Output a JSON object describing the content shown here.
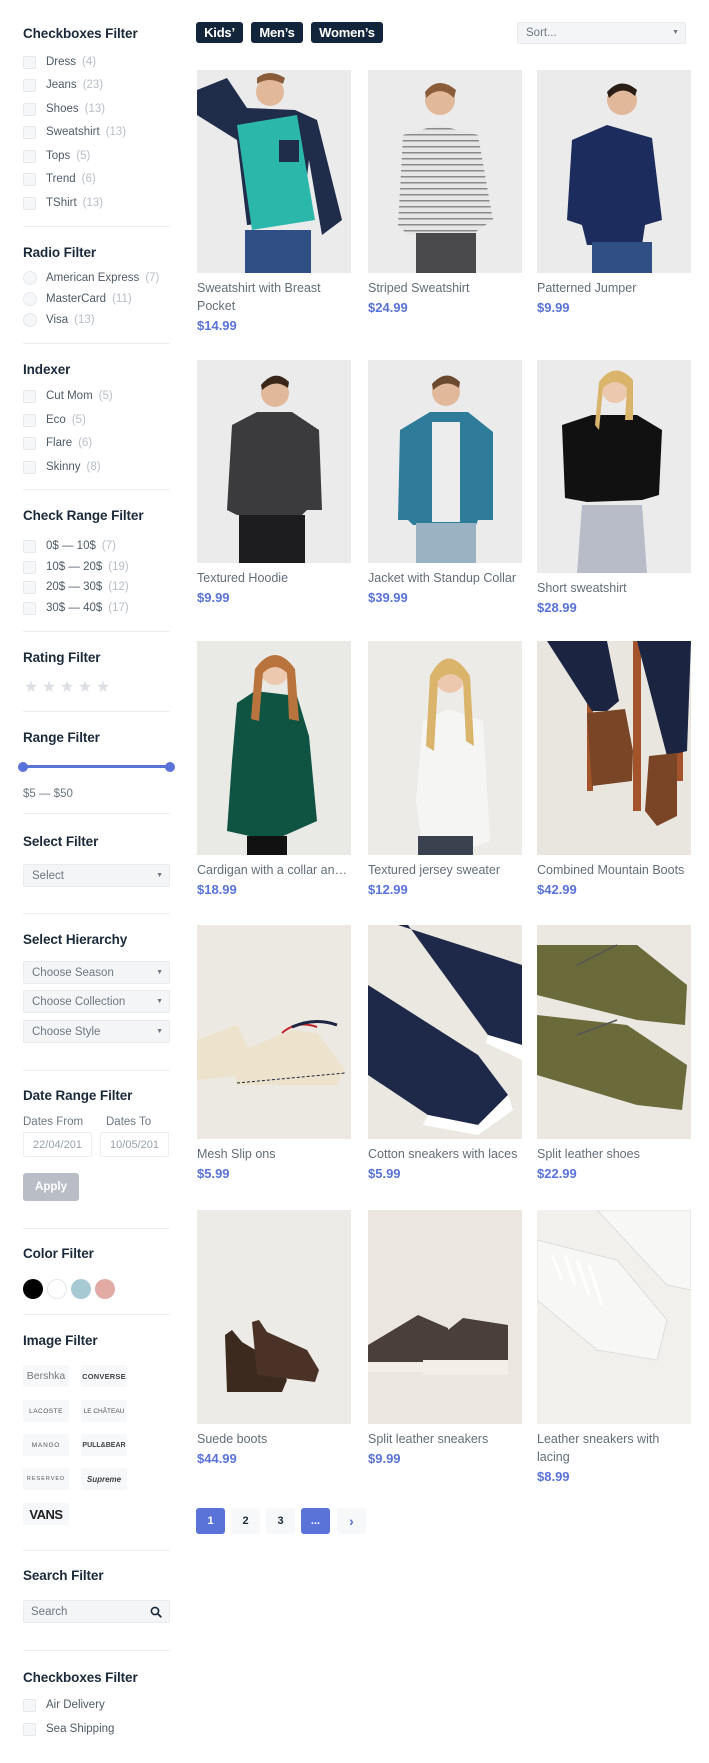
{
  "categories": [
    "Kids’",
    "Men’s",
    "Women’s"
  ],
  "sort": {
    "placeholder": "Sort..."
  },
  "sidebar": {
    "checkboxes_filter": {
      "title": "Checkboxes Filter",
      "items": [
        {
          "label": "Dress",
          "count": "(4)"
        },
        {
          "label": "Jeans",
          "count": "(23)"
        },
        {
          "label": "Shoes",
          "count": "(13)"
        },
        {
          "label": "Sweatshirt",
          "count": "(13)"
        },
        {
          "label": "Tops",
          "count": "(5)"
        },
        {
          "label": "Trend",
          "count": "(6)"
        },
        {
          "label": "TShirt",
          "count": "(13)"
        }
      ]
    },
    "radio_filter": {
      "title": "Radio Filter",
      "items": [
        {
          "label": "American Express",
          "count": "(7)"
        },
        {
          "label": "MasterCard",
          "count": "(11)"
        },
        {
          "label": "Visa",
          "count": "(13)"
        }
      ]
    },
    "indexer": {
      "title": "Indexer",
      "items": [
        {
          "label": "Cut Mom",
          "count": "(5)"
        },
        {
          "label": "Eco",
          "count": "(5)"
        },
        {
          "label": "Flare",
          "count": "(6)"
        },
        {
          "label": "Skinny",
          "count": "(8)"
        }
      ]
    },
    "check_range_filter": {
      "title": "Check Range Filter",
      "items": [
        {
          "label": "0$ — 10$",
          "count": "(7)"
        },
        {
          "label": "10$ — 20$",
          "count": "(19)"
        },
        {
          "label": "20$ — 30$",
          "count": "(12)"
        },
        {
          "label": "30$ — 40$",
          "count": "(17)"
        }
      ]
    },
    "rating_filter": {
      "title": "Rating Filter",
      "stars": 5,
      "selected": 0
    },
    "range_filter": {
      "title": "Range Filter",
      "min": 5,
      "max": 50,
      "low": 5,
      "high": 50,
      "text": "$5 — $50"
    },
    "select_filter": {
      "title": "Select Filter",
      "value": "Select"
    },
    "select_hierarchy": {
      "title": "Select Hierarchy",
      "selects": [
        "Choose Season",
        "Choose Collection",
        "Choose Style"
      ]
    },
    "date_range_filter": {
      "title": "Date Range Filter",
      "from_label": "Dates From",
      "to_label": "Dates To",
      "from_value": "22/04/201",
      "to_value": "10/05/201",
      "apply_label": "Apply"
    },
    "color_filter": {
      "title": "Color Filter",
      "colors": [
        "#000000",
        "#ffffff",
        "#a7c9d3",
        "#e1aba3"
      ]
    },
    "image_filter": {
      "title": "Image Filter",
      "brands": [
        "Bershka",
        "CONVERSE",
        "LACOSTE",
        "LE CHÂTEAU",
        "MANGO",
        "PULL&BEAR",
        "RESERVED",
        "Supreme",
        "VANS"
      ]
    },
    "search_filter": {
      "title": "Search Filter",
      "placeholder": "Search"
    },
    "shipping_filter": {
      "title": "Checkboxes Filter",
      "items": [
        {
          "label": "Air Delivery"
        },
        {
          "label": "Sea Shipping"
        }
      ]
    }
  },
  "products": [
    {
      "name": "Sweatshirt with Breast Pocket",
      "price": "$14.99"
    },
    {
      "name": "Striped Sweatshirt",
      "price": "$24.99"
    },
    {
      "name": "Patterned Jumper",
      "price": "$9.99"
    },
    {
      "name": "Textured Hoodie",
      "price": "$9.99"
    },
    {
      "name": "Jacket with Standup Collar",
      "price": "$39.99"
    },
    {
      "name": "Short sweatshirt",
      "price": "$28.99"
    },
    {
      "name": "Cardigan with a collar and...",
      "price": "$18.99"
    },
    {
      "name": "Textured jersey sweater",
      "price": "$12.99"
    },
    {
      "name": "Combined Mountain Boots",
      "price": "$42.99"
    },
    {
      "name": "Mesh Slip ons",
      "price": "$5.99"
    },
    {
      "name": "Cotton sneakers with laces",
      "price": "$5.99"
    },
    {
      "name": "Split leather shoes",
      "price": "$22.99"
    },
    {
      "name": "Suede boots",
      "price": "$44.99"
    },
    {
      "name": "Split leather sneakers",
      "price": "$9.99"
    },
    {
      "name": "Leather sneakers with lacing",
      "price": "$8.99"
    }
  ],
  "pagination": {
    "pages": [
      "1",
      "2",
      "3",
      "..."
    ],
    "current": "1",
    "next_label": "›"
  },
  "colors": {
    "accent": "#5a73d9",
    "navy": "#13253a"
  }
}
